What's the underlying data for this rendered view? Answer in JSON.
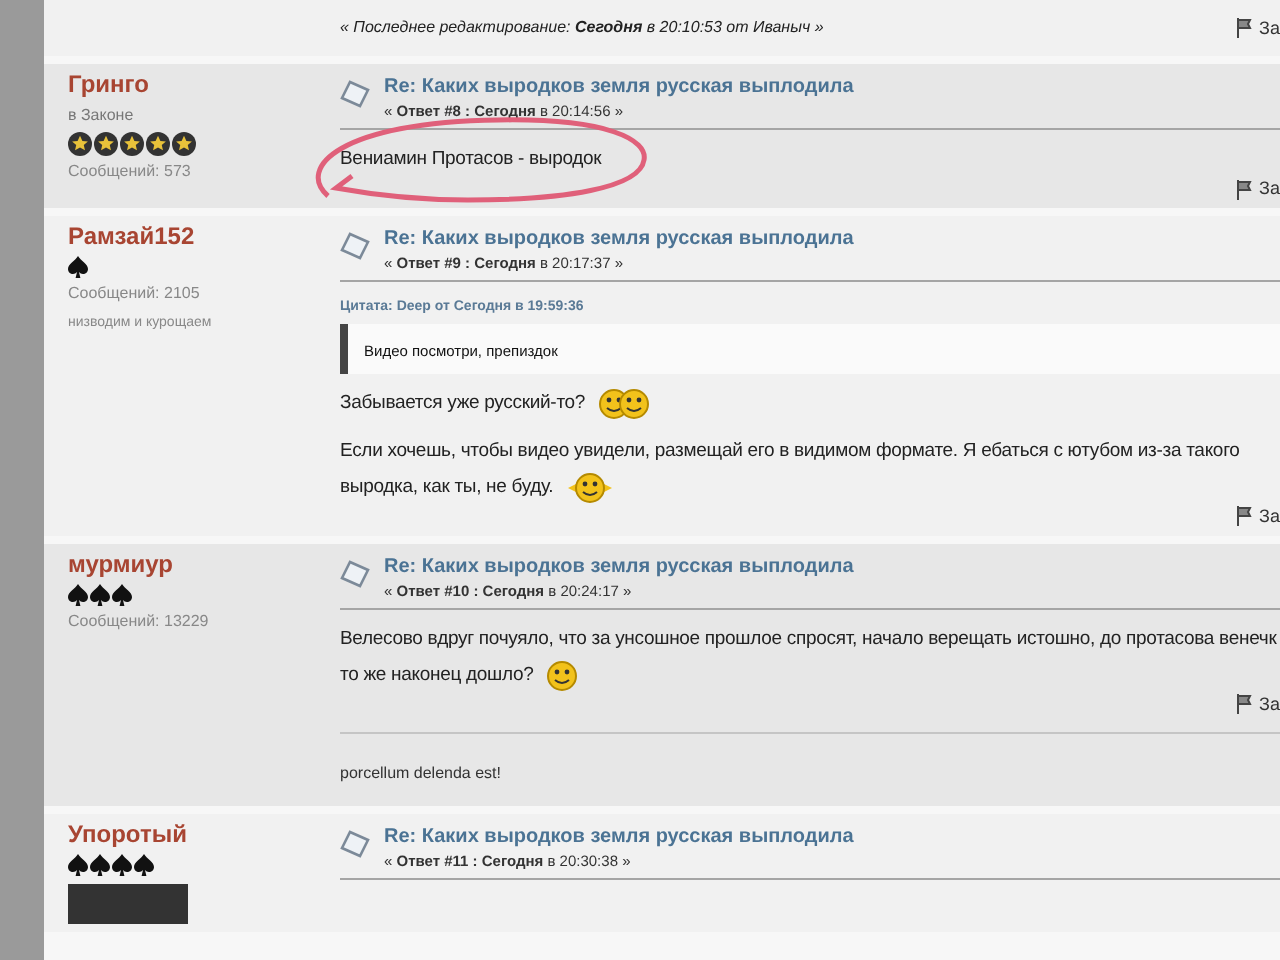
{
  "top_post": {
    "edit_note": "« Последнее редактирование: **Сегодня** в 20:10:53 от Иваныч »",
    "report": "За"
  },
  "posts": [
    {
      "author": "Гринго",
      "rank": "в Законе",
      "rank_icons": [
        {
          "kind": "star"
        },
        {
          "kind": "star"
        },
        {
          "kind": "star"
        },
        {
          "kind": "star"
        },
        {
          "kind": "star"
        }
      ],
      "posts_count": "Сообщений: 573",
      "title": "Re: Каких выродков земля русская выплодила",
      "meta": "« **Ответ #8 : Сегодня** в 20:14:56 »",
      "paragraphs": [
        {
          "lines": [
            "Вениамин Протасов - выродок"
          ]
        }
      ],
      "circled": true,
      "report": "За"
    },
    {
      "author": "Рамзай152",
      "rank_icons": [
        {
          "kind": "spade"
        }
      ],
      "posts_count": "Сообщений: 2105",
      "personal_text": "низводим и курощаем",
      "title": "Re: Каких выродков земля русская выплодила",
      "meta": "« **Ответ #9 : Сегодня** в 20:17:37 »",
      "quote": {
        "header": "Цитата: Deep от Сегодня в 19:59:36",
        "text": "Видео посмотри, препиздок"
      },
      "paragraphs": [
        {
          "lines": [
            "Забывается уже русский-то?"
          ],
          "smiley": {
            "kind": "pair"
          }
        },
        {
          "lines": [
            "Если хочешь, чтобы видео увидели, размещай его в видимом формате. Я ебаться с ютубом из-за такого",
            "выродка, как ты, не буду."
          ],
          "smiley": {
            "kind": "laughing"
          }
        }
      ],
      "circled": false,
      "report": "За"
    },
    {
      "author": "мурмиур",
      "rank_icons": [
        {
          "kind": "spade"
        },
        {
          "kind": "spade"
        },
        {
          "kind": "spade"
        }
      ],
      "posts_count": "Сообщений: 13229",
      "title": "Re: Каких выродков земля русская выплодила",
      "meta": "« **Ответ #10 : Сегодня** в 20:24:17 »",
      "paragraphs": [
        {
          "lines": [
            "Велесово вдруг почуяло, что за унсошное прошлое спросят, начало верещать истошно, до протасова венечк",
            "то же наконец дошло?"
          ],
          "smiley": {
            "kind": "grin"
          }
        }
      ],
      "circled": false,
      "report": "За",
      "signature": "porcellum delenda est!"
    },
    {
      "author": "Упоротый",
      "rank_icons": [
        {
          "kind": "spade"
        },
        {
          "kind": "spade"
        },
        {
          "kind": "spade"
        },
        {
          "kind": "spade"
        }
      ],
      "avatar": true,
      "title": "Re: Каких выродков земля русская выплодила",
      "meta": "« **Ответ #11 : Сегодня** в 20:30:38 »",
      "circled": false
    }
  ]
}
